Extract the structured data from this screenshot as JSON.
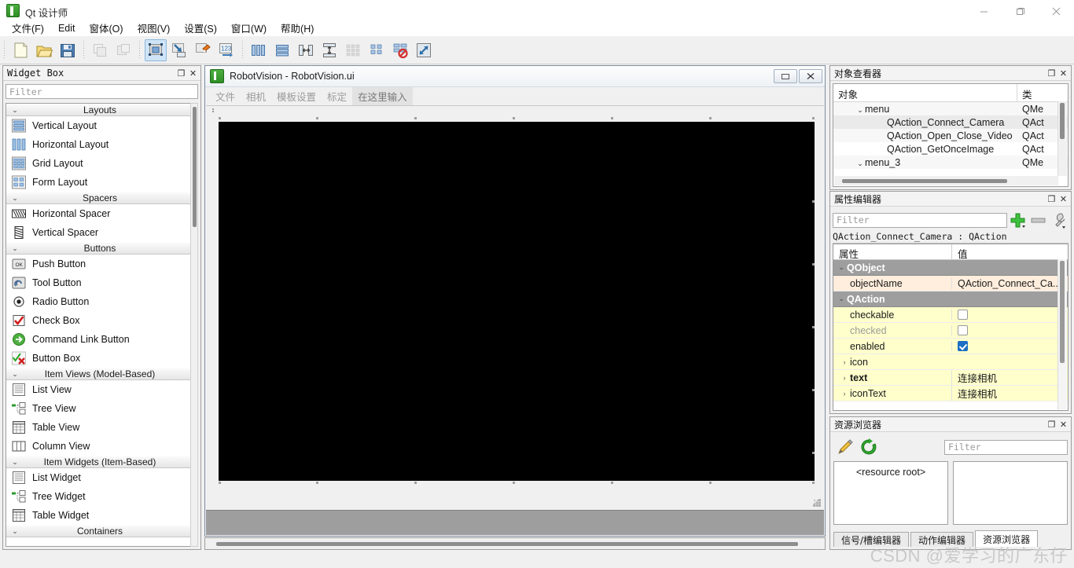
{
  "window": {
    "title": "Qt 设计师",
    "app_icon": "qt-logo-icon",
    "minimize": "—",
    "maximize": "❐",
    "close": "✕"
  },
  "menubar": {
    "items": [
      {
        "label": "文件(F)",
        "name": "menu-file"
      },
      {
        "label": "Edit",
        "name": "menu-edit"
      },
      {
        "label": "窗体(O)",
        "name": "menu-form"
      },
      {
        "label": "视图(V)",
        "name": "menu-view"
      },
      {
        "label": "设置(S)",
        "name": "menu-settings"
      },
      {
        "label": "窗口(W)",
        "name": "menu-window"
      },
      {
        "label": "帮助(H)",
        "name": "menu-help"
      }
    ]
  },
  "toolbar": {
    "groups": [
      [
        "new-file-icon",
        "open-file-icon",
        "save-file-icon"
      ],
      [
        "undo-icon",
        "redo-icon"
      ],
      [
        "edit-widgets-icon",
        "edit-signals-slots-icon",
        "edit-buddies-icon",
        "edit-tab-order-icon"
      ],
      [
        "layout-horizontally-icon",
        "layout-vertically-icon",
        "layout-splitter-horizontal-icon",
        "layout-splitter-vertical-icon",
        "layout-grid-icon",
        "layout-form-icon",
        "break-layout-icon",
        "adjust-size-icon"
      ]
    ]
  },
  "widget_box": {
    "title": "Widget Box",
    "float_btn": "❐",
    "close_btn": "✕",
    "filter_placeholder": "Filter",
    "categories": [
      {
        "name": "Layouts",
        "items": [
          {
            "label": "Vertical Layout",
            "icon": "vertical-layout-icon"
          },
          {
            "label": "Horizontal Layout",
            "icon": "horizontal-layout-icon"
          },
          {
            "label": "Grid Layout",
            "icon": "grid-layout-icon"
          },
          {
            "label": "Form Layout",
            "icon": "form-layout-icon"
          }
        ]
      },
      {
        "name": "Spacers",
        "items": [
          {
            "label": "Horizontal Spacer",
            "icon": "horizontal-spacer-icon"
          },
          {
            "label": "Vertical Spacer",
            "icon": "vertical-spacer-icon"
          }
        ]
      },
      {
        "name": "Buttons",
        "items": [
          {
            "label": "Push Button",
            "icon": "push-button-icon"
          },
          {
            "label": "Tool Button",
            "icon": "tool-button-icon"
          },
          {
            "label": "Radio Button",
            "icon": "radio-button-icon"
          },
          {
            "label": "Check Box",
            "icon": "check-box-icon"
          },
          {
            "label": "Command Link Button",
            "icon": "command-link-button-icon"
          },
          {
            "label": "Button Box",
            "icon": "button-box-icon"
          }
        ]
      },
      {
        "name": "Item Views (Model-Based)",
        "items": [
          {
            "label": "List View",
            "icon": "list-view-icon"
          },
          {
            "label": "Tree View",
            "icon": "tree-view-icon"
          },
          {
            "label": "Table View",
            "icon": "table-view-icon"
          },
          {
            "label": "Column View",
            "icon": "column-view-icon"
          }
        ]
      },
      {
        "name": "Item Widgets (Item-Based)",
        "items": [
          {
            "label": "List Widget",
            "icon": "list-widget-icon"
          },
          {
            "label": "Tree Widget",
            "icon": "tree-widget-icon"
          },
          {
            "label": "Table Widget",
            "icon": "table-widget-icon"
          }
        ]
      },
      {
        "name": "Containers",
        "items": []
      }
    ]
  },
  "form_window": {
    "title": "RobotVision - RobotVision.ui",
    "icon": "qt-logo-icon",
    "restore_btn": "▭",
    "close_btn": "✕",
    "menus": [
      {
        "label": "文件"
      },
      {
        "label": "相机"
      },
      {
        "label": "模板设置"
      },
      {
        "label": "标定"
      },
      {
        "label": "在这里输入",
        "placeholder": true
      }
    ],
    "canvas_widget": {
      "name": "video-display-widget",
      "color": "#000000"
    }
  },
  "object_inspector": {
    "title": "对象查看器",
    "float_btn": "❐",
    "close_btn": "✕",
    "columns": [
      "对象",
      "类"
    ],
    "rows": [
      {
        "name": "menu",
        "class": "QMe",
        "indent": 2,
        "expandable": true
      },
      {
        "name": "QAction_Connect_Camera",
        "class": "QAct",
        "indent": 4,
        "expandable": false,
        "selected": true
      },
      {
        "name": "QAction_Open_Close_Video",
        "class": "QAct",
        "indent": 4,
        "expandable": false
      },
      {
        "name": "QAction_GetOnceImage",
        "class": "QAct",
        "indent": 4,
        "expandable": false
      },
      {
        "name": "menu_3",
        "class": "QMe",
        "indent": 2,
        "expandable": true
      }
    ]
  },
  "property_editor": {
    "title": "属性编辑器",
    "float_btn": "❐",
    "close_btn": "✕",
    "filter_placeholder": "Filter",
    "buttons": [
      "add-property-icon",
      "remove-property-icon",
      "configure-icon"
    ],
    "object_line": "QAction_Connect_Camera : QAction",
    "columns": [
      "属性",
      "值"
    ],
    "rows": [
      {
        "key": "QObject",
        "value": "",
        "type": "group"
      },
      {
        "key": "objectName",
        "value": "QAction_Connect_Ca...",
        "type": "peach"
      },
      {
        "key": "QAction",
        "value": "",
        "type": "group"
      },
      {
        "key": "checkable",
        "value": "",
        "type": "yellow",
        "checkbox": false
      },
      {
        "key": "checked",
        "value": "",
        "type": "yellow",
        "checkbox": false,
        "dim": true
      },
      {
        "key": "enabled",
        "value": "",
        "type": "yellow",
        "checkbox": true
      },
      {
        "key": "icon",
        "value": "",
        "type": "yellow",
        "expandable": true
      },
      {
        "key": "text",
        "value": "连接相机",
        "type": "yellow",
        "expandable": true,
        "bold": true
      },
      {
        "key": "iconText",
        "value": "连接相机",
        "type": "yellow",
        "expandable": true
      }
    ]
  },
  "resource_browser": {
    "title": "资源浏览器",
    "float_btn": "❐",
    "close_btn": "✕",
    "filter_placeholder": "Filter",
    "buttons": [
      "edit-resources-icon",
      "reload-icon"
    ],
    "tree_root": "<resource root>",
    "preview": "",
    "tabs": [
      {
        "label": "信号/槽编辑器",
        "active": false
      },
      {
        "label": "动作编辑器",
        "active": false
      },
      {
        "label": "资源浏览器",
        "active": true
      }
    ]
  },
  "watermark": {
    "text": "CSDN @爱学习的广东仔"
  }
}
